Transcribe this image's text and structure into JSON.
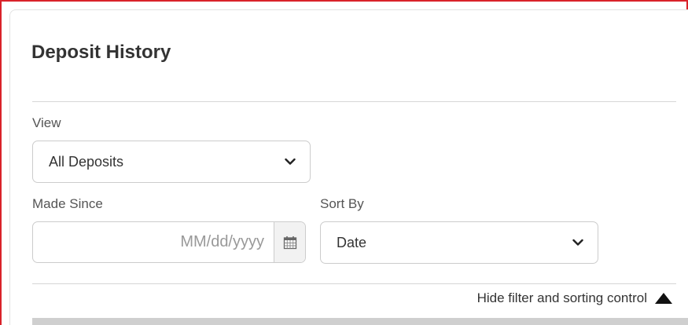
{
  "page": {
    "title": "Deposit History"
  },
  "filters": {
    "view_label": "View",
    "view_value": "All Deposits",
    "made_since_label": "Made Since",
    "made_since_placeholder": "MM/dd/yyyy",
    "sort_by_label": "Sort By",
    "sort_by_value": "Date"
  },
  "toggle": {
    "label": "Hide filter and sorting control"
  },
  "icons": {
    "calendar": "calendar-icon",
    "select_arrow": "chevron-down-icon",
    "collapse": "triangle-up-icon"
  },
  "colors": {
    "frame_border": "#d9222a",
    "text": "#333333",
    "label": "#555555",
    "placeholder": "#999999",
    "input_border": "#cccccc"
  }
}
